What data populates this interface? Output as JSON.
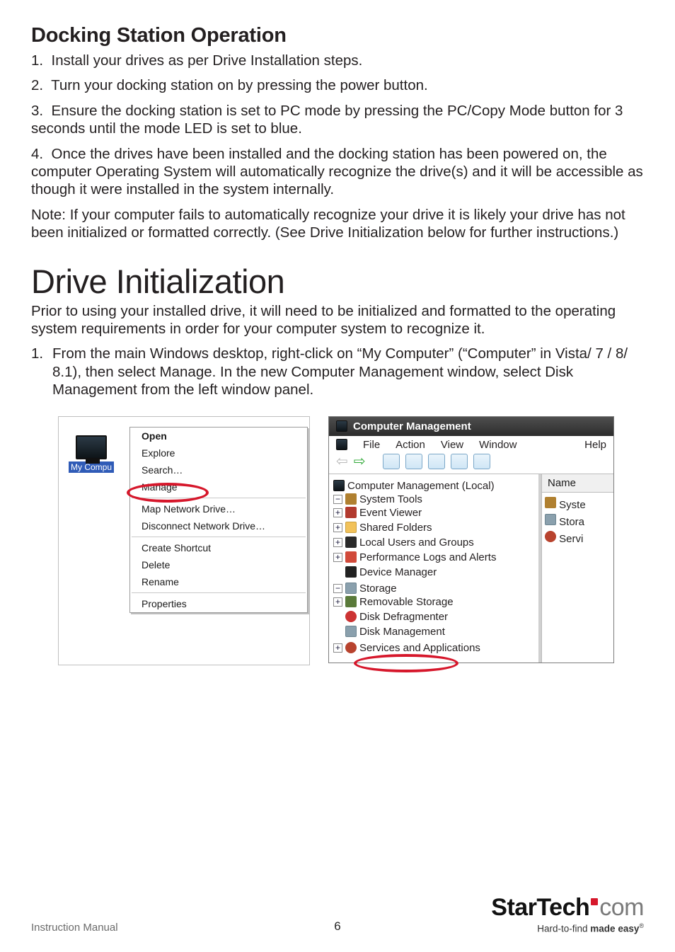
{
  "headings": {
    "section": "Docking Station Operation",
    "big": "Drive Initialization"
  },
  "dock_steps": {
    "s1": {
      "num": "1.",
      "text": "Install your drives as per Drive Installation steps."
    },
    "s2": {
      "num": "2.",
      "text": "Turn your docking station on by pressing the power button."
    },
    "s3": {
      "num": "3.",
      "text": "Ensure the docking station is set to PC mode by pressing the PC/Copy Mode button for 3 seconds until the mode LED is set to blue."
    },
    "s4": {
      "num": "4.",
      "text": "Once the drives have been installed and the docking station has been powered on, the computer Operating System will automatically recognize the drive(s) and it will be accessible as though it were installed in the system internally."
    }
  },
  "note": "Note: If your computer fails to automatically recognize your drive it is likely your drive has not been initialized or formatted correctly. (See Drive Initialization below for further instructions.)",
  "init_intro": "Prior to using your installed drive, it will need to be initialized and formatted to the operating system requirements in order for your computer system to recognize it.",
  "init_step1": {
    "num": "1.",
    "text": "From the main Windows desktop, right-click on “My Computer” (“Computer” in Vista/ 7 / 8/ 8.1), then select Manage. In the new Computer Management window, select Disk Management from the left window panel."
  },
  "ctx": {
    "icon_label": "My Compu",
    "items": {
      "open": "Open",
      "explore": "Explore",
      "search": "Search…",
      "manage": "Manage",
      "map": "Map Network Drive…",
      "disconnect": "Disconnect Network Drive…",
      "shortcut": "Create Shortcut",
      "delete": "Delete",
      "rename": "Rename",
      "properties": "Properties"
    }
  },
  "mmc": {
    "title": "Computer Management",
    "menu": {
      "file": "File",
      "action": "Action",
      "view": "View",
      "window": "Window",
      "help": "Help"
    },
    "tree": {
      "root": "Computer Management (Local)",
      "system_tools": "System Tools",
      "event_viewer": "Event Viewer",
      "shared_folders": "Shared Folders",
      "local_users": "Local Users and Groups",
      "perf": "Performance Logs and Alerts",
      "devmgr": "Device Manager",
      "storage": "Storage",
      "removable": "Removable Storage",
      "defrag": "Disk Defragmenter",
      "diskmgmt": "Disk Management",
      "services": "Services and Applications"
    },
    "list": {
      "hdr": "Name",
      "r1": "Syste",
      "r2": "Stora",
      "r3": "Servi"
    }
  },
  "footer": {
    "im": "Instruction Manual",
    "page": "6",
    "brand1": "StarTech",
    "brand2": "com",
    "tag_pre": "Hard-to-find ",
    "tag_bold": "made easy",
    "tag_reg": "®"
  }
}
